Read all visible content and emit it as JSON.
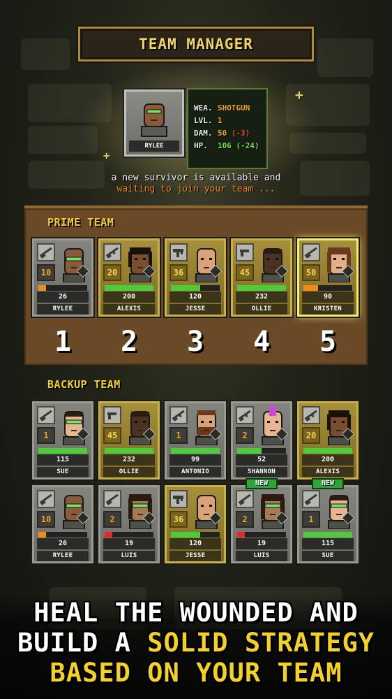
{
  "header": {
    "title": "TEAM MANAGER"
  },
  "new_survivor": {
    "name": "RYLEE",
    "stats": [
      {
        "key": "WEA.",
        "value": "SHOTGUN",
        "extra": ""
      },
      {
        "key": "LVL.",
        "value": "1",
        "extra": ""
      },
      {
        "key": "DAM.",
        "value": "50",
        "extra": "(-3)"
      },
      {
        "key": "HP.",
        "value": "106",
        "extra": "(-24)"
      }
    ],
    "message_line1": "a new survivor is available and",
    "message_line2": "waiting to join your team ..."
  },
  "prime_team": {
    "title": "PRIME TEAM",
    "slot_numbers": [
      "1",
      "2",
      "3",
      "4",
      "5"
    ],
    "members": [
      {
        "name": "RYLEE",
        "level": "10",
        "hp": "26",
        "hp_fraction": 0.15,
        "hp_color": "#f08a1a",
        "style": "silver",
        "skin": "#8a5a3a",
        "hair": "bald",
        "glasses": true,
        "weapon": "shotgun-icon"
      },
      {
        "name": "ALEXIS",
        "level": "20",
        "hp": "200",
        "hp_fraction": 1.0,
        "hp_color": "#4ccc3a",
        "style": "gold",
        "skin": "#7a4e30",
        "hair": "dreads",
        "glasses": false,
        "weapon": "rifle-icon"
      },
      {
        "name": "JESSE",
        "level": "36",
        "hp": "120",
        "hp_fraction": 0.6,
        "hp_color": "#4ccc3a",
        "style": "gold",
        "skin": "#d9a27a",
        "hair": "bald",
        "glasses": false,
        "weapon": "uzi-icon"
      },
      {
        "name": "OLLIE",
        "level": "45",
        "hp": "232",
        "hp_fraction": 1.0,
        "hp_color": "#4ccc3a",
        "style": "gold",
        "skin": "#4b3222",
        "hair": "short",
        "glasses": false,
        "weapon": "pistol-icon"
      },
      {
        "name": "KRISTEN",
        "level": "50",
        "hp": "90",
        "hp_fraction": 0.3,
        "hp_color": "#f08a1a",
        "style": "selected",
        "skin": "#e0b08a",
        "hair": "long",
        "glasses": false,
        "weapon": "shotgun-icon"
      }
    ]
  },
  "backup_team": {
    "title": "BACKUP TEAM",
    "members": [
      {
        "name": "SUE",
        "level": "1",
        "hp": "115",
        "hp_fraction": 1.0,
        "hp_color": "#4ccc3a",
        "style": "silver",
        "skin": "#e6b592",
        "hair": "short",
        "glasses": true,
        "weapon": "shotgun-icon",
        "is_new": false
      },
      {
        "name": "OLLIE",
        "level": "45",
        "hp": "232",
        "hp_fraction": 1.0,
        "hp_color": "#4ccc3a",
        "style": "gold",
        "skin": "#4b3222",
        "hair": "short",
        "glasses": false,
        "weapon": "pistol-icon",
        "is_new": false
      },
      {
        "name": "ANTONIO",
        "level": "1",
        "hp": "99",
        "hp_fraction": 1.0,
        "hp_color": "#4ccc3a",
        "style": "silver",
        "skin": "#d8a07a",
        "hair": "beard",
        "glasses": false,
        "weapon": "rifle-icon",
        "is_new": false
      },
      {
        "name": "SHANNON",
        "level": "2",
        "hp": "52",
        "hp_fraction": 0.5,
        "hp_color": "#4ccc3a",
        "style": "silver",
        "skin": "#e6b592",
        "hair": "mohawk",
        "glasses": false,
        "weapon": "rifle-icon",
        "is_new": false
      },
      {
        "name": "ALEXIS",
        "level": "20",
        "hp": "200",
        "hp_fraction": 1.0,
        "hp_color": "#4ccc3a",
        "style": "gold",
        "skin": "#7a4e30",
        "hair": "dreads",
        "glasses": false,
        "weapon": "rifle-icon",
        "is_new": false
      },
      {
        "name": "RYLEE",
        "level": "10",
        "hp": "26",
        "hp_fraction": 0.15,
        "hp_color": "#f08a1a",
        "style": "silver",
        "skin": "#8a5a3a",
        "hair": "bald",
        "glasses": true,
        "weapon": "shotgun-icon",
        "is_new": false
      },
      {
        "name": "LUIS",
        "level": "2",
        "hp": "19",
        "hp_fraction": 0.15,
        "hp_color": "#e02a2a",
        "style": "silver",
        "skin": "#a57a55",
        "hair": "long-dark",
        "glasses": true,
        "weapon": "shotgun-icon",
        "is_new": false
      },
      {
        "name": "JESSE",
        "level": "36",
        "hp": "120",
        "hp_fraction": 0.6,
        "hp_color": "#4ccc3a",
        "style": "gold",
        "skin": "#d9a27a",
        "hair": "bald",
        "glasses": false,
        "weapon": "uzi-icon",
        "is_new": false
      },
      {
        "name": "LUIS",
        "level": "2",
        "hp": "19",
        "hp_fraction": 0.15,
        "hp_color": "#e02a2a",
        "style": "silver",
        "skin": "#a57a55",
        "hair": "long-dark",
        "glasses": true,
        "weapon": "shotgun-icon",
        "is_new": true
      },
      {
        "name": "SUE",
        "level": "1",
        "hp": "115",
        "hp_fraction": 1.0,
        "hp_color": "#4ccc3a",
        "style": "silver",
        "skin": "#e6b592",
        "hair": "short",
        "glasses": true,
        "weapon": "shotgun-icon",
        "is_new": true
      }
    ],
    "new_badge_label": "NEW"
  },
  "banner": {
    "line1": "HEAL THE WOUNDED AND",
    "line2_white": "BUILD A ",
    "line2_yellow": "SOLID STRATEGY",
    "line3": "BASED ON YOUR TEAM"
  },
  "colors": {
    "accent_yellow": "#f4d02a",
    "title_gold": "#f3d46a",
    "panel_brown": "#6a4a26"
  }
}
